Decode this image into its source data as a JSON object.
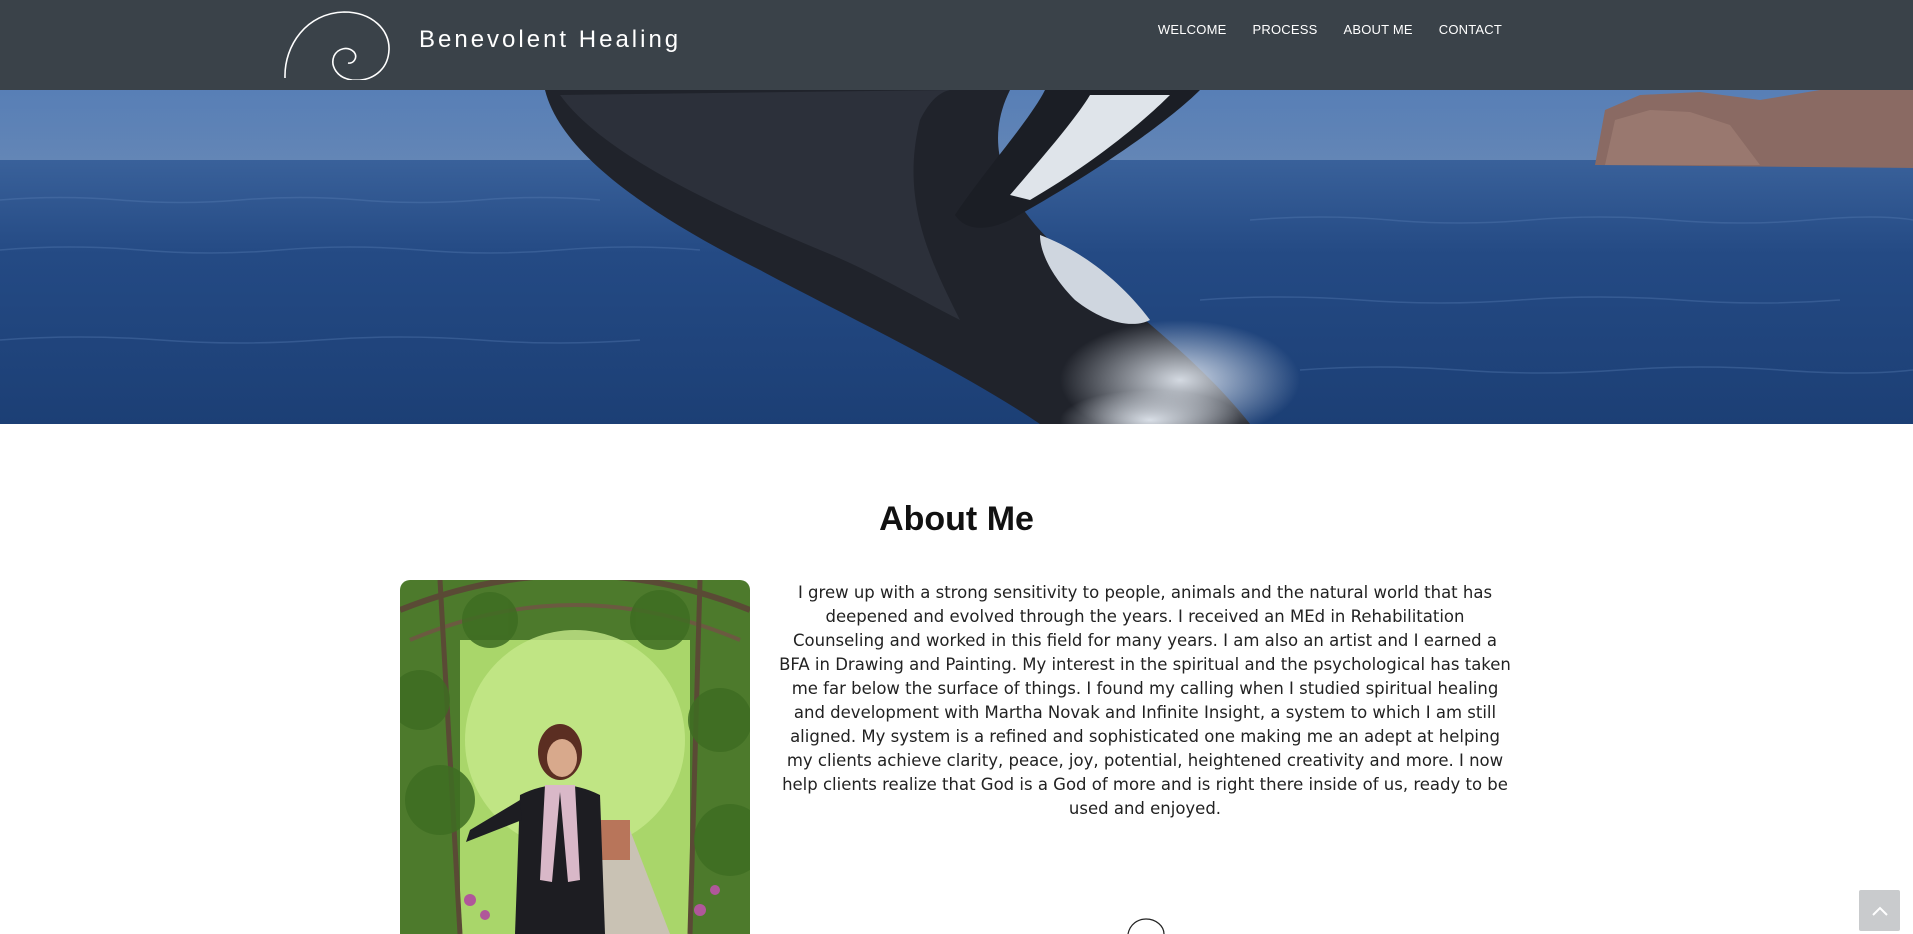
{
  "brand": {
    "name": "Benevolent Healing",
    "logo_icon": "spiral-logo-icon"
  },
  "nav": {
    "items": [
      {
        "label": "WELCOME"
      },
      {
        "label": "PROCESS"
      },
      {
        "label": "ABOUT ME"
      },
      {
        "label": "CONTACT"
      }
    ]
  },
  "hero": {
    "image": "humpback-whale-breaching-ocean"
  },
  "about": {
    "title": "About Me",
    "photo": "woman-in-garden-arbor-photo",
    "body": "I grew up with a strong sensitivity to people, animals and the natural world that has deepened and evolved through the years. I received an MEd in Rehabilitation Counseling and worked in this field for many years. I am also an artist and I earned a BFA in Drawing and Painting. My interest in the spiritual and the psychological has taken me far below the surface of things. I found my calling when I studied spiritual healing and development with Martha Novak and Infinite Insight, a system to which I am still aligned. My system is a refined and sophisticated one making me an adept at helping my clients achieve clarity, peace, joy, potential, heightened creativity and more. I now help clients realize that God is a God of more and is right there inside of us, ready to be used and enjoyed."
  },
  "scroll_top": {
    "icon": "chevron-up-icon"
  },
  "colors": {
    "header_bg": "#3a4249",
    "ocean": "#24477a",
    "scroll_button": "#c9cbcd"
  }
}
